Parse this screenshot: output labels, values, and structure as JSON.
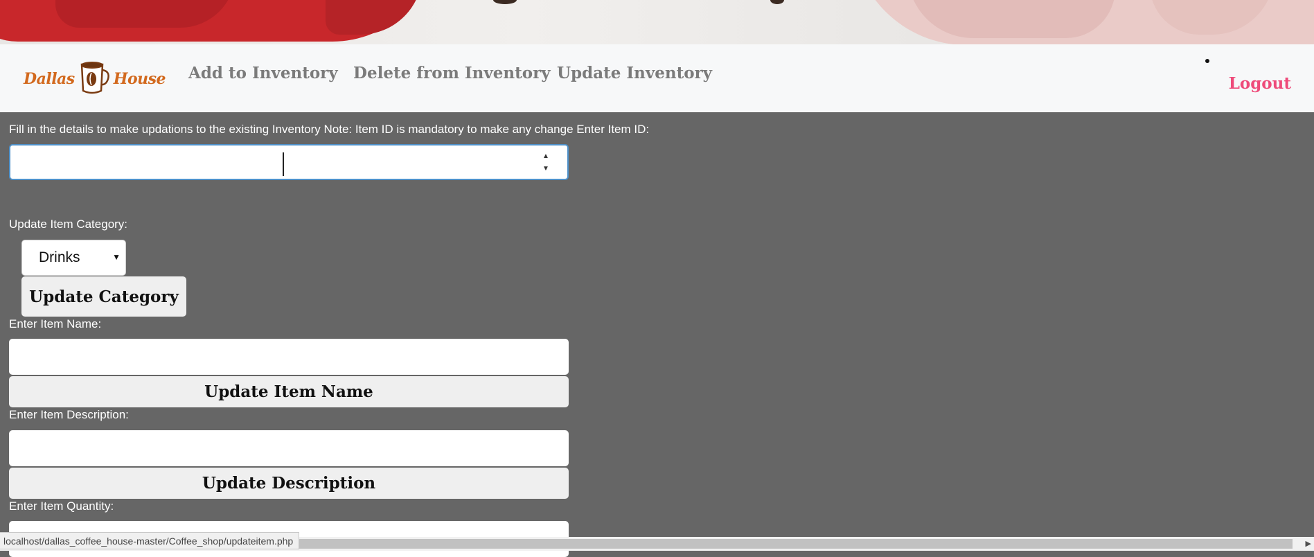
{
  "brand": {
    "word_left": "Dallas",
    "word_right": "House",
    "color": "#d2691e",
    "icon": "coffee-cup-icon"
  },
  "nav": {
    "links": [
      "Add to Inventory",
      "Delete from Inventory",
      "Update Inventory"
    ],
    "logout": "Logout",
    "link_color": "#7b7b7b",
    "logout_color": "#ee4b7a"
  },
  "form": {
    "intro": "Fill in the details to make updations to the existing Inventory Note: Item ID is mandatory to make any change Enter Item ID:",
    "item_id_value": "",
    "category_label": "Update Item Category:",
    "category_selected": "Drinks",
    "update_category_button": "Update Category",
    "name_label": "Enter Item Name:",
    "name_value": "",
    "update_name_button": "Update Item Name",
    "description_label": "Enter Item Description:",
    "description_value": "",
    "update_description_button": "Update Description",
    "quantity_label": "Enter Item Quantity:"
  },
  "status_bar": {
    "url": "localhost/dallas_coffee_house-master/Coffee_shop/updateitem.php"
  },
  "colors": {
    "page_bg": "#666666",
    "navbar_bg": "#f7f8f9",
    "focus_border": "#4d90c9"
  }
}
